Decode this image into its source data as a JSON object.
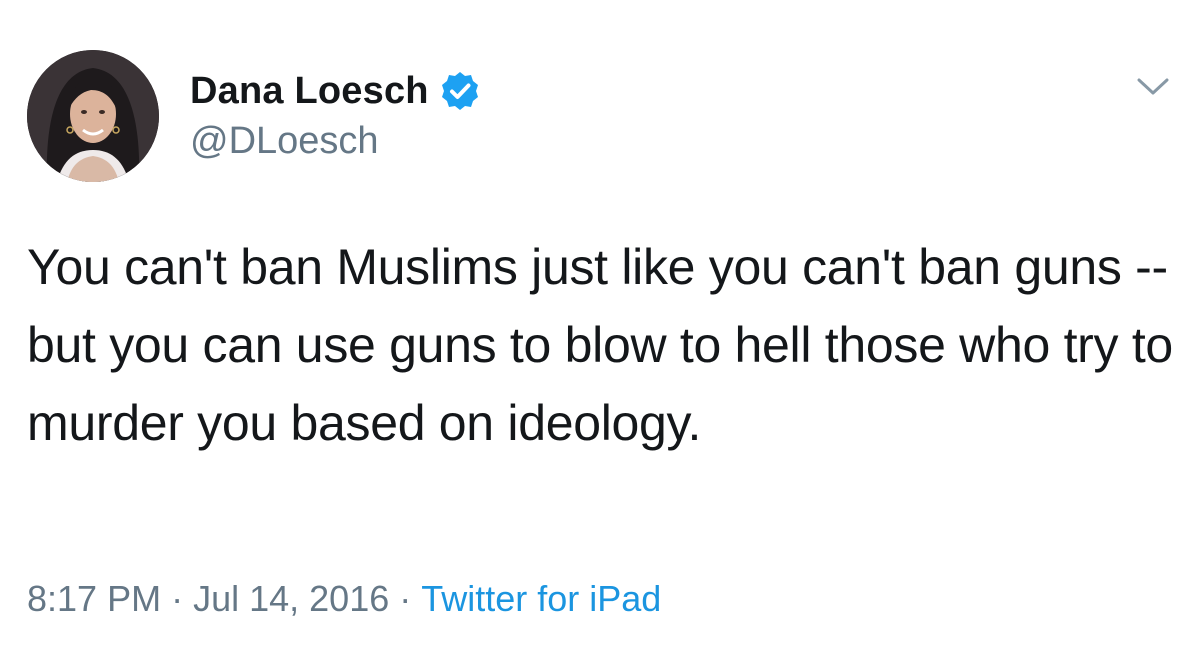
{
  "author": {
    "display_name": "Dana Loesch",
    "handle": "@DLoesch",
    "verified": true,
    "avatar_icon": "profile-photo",
    "verified_icon": "verified-badge-icon"
  },
  "menu": {
    "icon": "chevron-down-icon"
  },
  "tweet": {
    "text": "You can't ban Muslims just like you can't ban guns -- but you can use guns to blow to hell those who try to murder you based on ideology."
  },
  "meta": {
    "time": "8:17 PM",
    "separator": "·",
    "date": "Jul 14, 2016",
    "source": "Twitter for iPad"
  },
  "colors": {
    "text": "#14171a",
    "secondary": "#657786",
    "link": "#1b95e0",
    "verified_badge": "#1da1f2",
    "background": "#ffffff"
  }
}
